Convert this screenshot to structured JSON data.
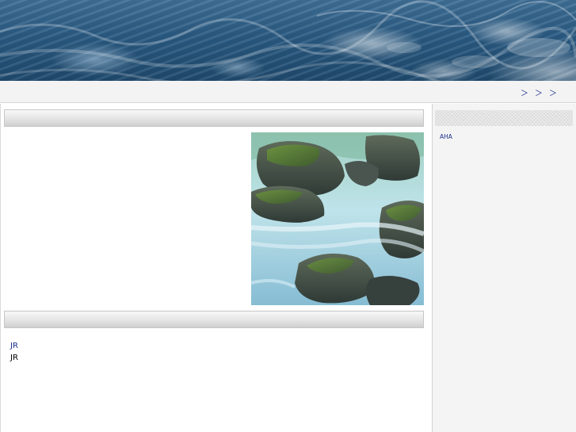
{
  "header": {
    "site_title": "",
    "colors": {
      "title_text": "#ffffff",
      "banner_dark": "#1f4a6e",
      "banner_light": "#3f6f96"
    }
  },
  "nav": {
    "home_label": "",
    "links": [
      "",
      "",
      "",
      ""
    ],
    "link_color": "#1b2f8a"
  },
  "main": {
    "section1_title": " ",
    "intro_text": "",
    "photo_icon": "river-rocks-photo",
    "section2_title": "",
    "link_items": [
      {
        "title": "JR",
        "desc": "JR"
      },
      {
        "title": "",
        "desc": ""
      },
      {
        "title": "",
        "desc": ""
      }
    ]
  },
  "sidebar": {
    "heading": "",
    "items": [
      "AHA",
      "",
      "",
      "",
      "",
      "",
      "",
      "",
      "",
      "",
      "",
      "",
      "",
      "",
      "",
      "",
      "",
      "",
      "",
      "",
      "",
      "",
      "",
      "",
      "",
      "",
      "",
      "",
      "",
      "",
      "",
      "",
      "",
      "",
      ""
    ]
  }
}
